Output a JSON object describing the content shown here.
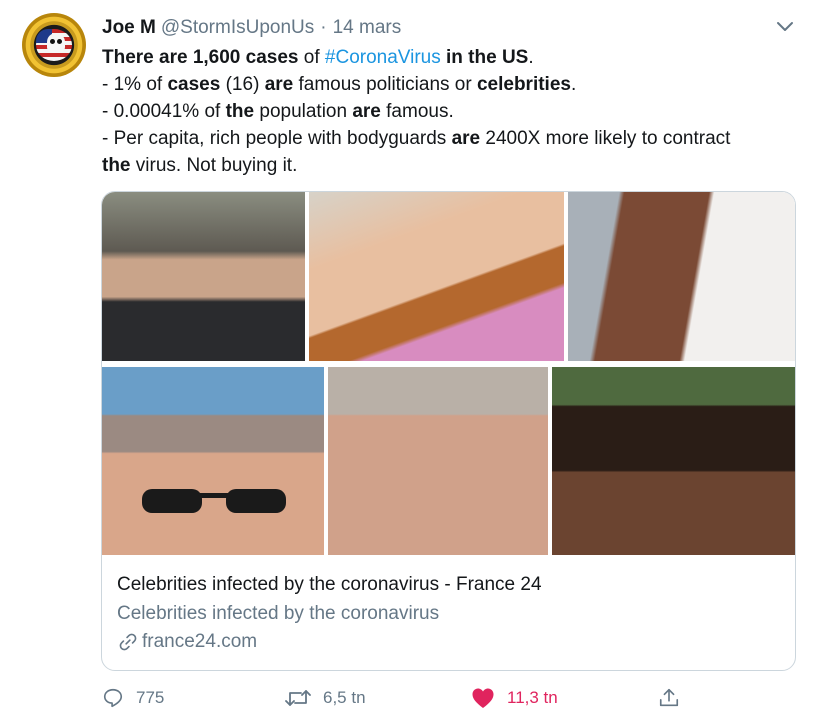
{
  "tweet": {
    "user": {
      "name": "Joe M",
      "handle": "@StormIsUponUs",
      "separator": "·",
      "date": "14 mars"
    },
    "text_lines": [
      [
        {
          "t": "There are 1,600 cases",
          "b": true
        },
        {
          "t": " of ",
          "b": false
        },
        {
          "t": "#CoronaVirus",
          "h": true
        },
        {
          "t": " in the US",
          "b": true
        },
        {
          "t": ".",
          "b": false
        }
      ],
      [
        {
          "t": "- 1% of ",
          "b": false
        },
        {
          "t": "cases",
          "b": true
        },
        {
          "t": " (16) ",
          "b": false
        },
        {
          "t": "are",
          "b": true
        },
        {
          "t": " famous politicians or ",
          "b": false
        },
        {
          "t": "celebrities",
          "b": true
        },
        {
          "t": ".",
          "b": false
        }
      ],
      [
        {
          "t": "- 0.00041% of ",
          "b": false
        },
        {
          "t": "the",
          "b": true
        },
        {
          "t": " population ",
          "b": false
        },
        {
          "t": "are",
          "b": true
        },
        {
          "t": " famous.",
          "b": false
        }
      ],
      [
        {
          "t": "- Per capita, rich people with bodyguards ",
          "b": false
        },
        {
          "t": "are",
          "b": true
        },
        {
          "t": " 2400X more likely to contract",
          "b": false
        }
      ],
      [
        {
          "t": "the",
          "b": true
        },
        {
          "t": " virus. Not buying it.",
          "b": false
        }
      ]
    ],
    "card": {
      "title": "Celebrities infected by the coronavirus - France 24",
      "description": "Celebrities infected by the coronavirus",
      "domain": "france24.com",
      "photo_count": 6
    },
    "actions": {
      "replies": "775",
      "retweets": "6,5 tn",
      "likes": "11,3 tn"
    },
    "colors": {
      "link": "#1b95e0",
      "muted": "#657786",
      "like": "#e0245e",
      "border": "#ccd6dd"
    }
  }
}
